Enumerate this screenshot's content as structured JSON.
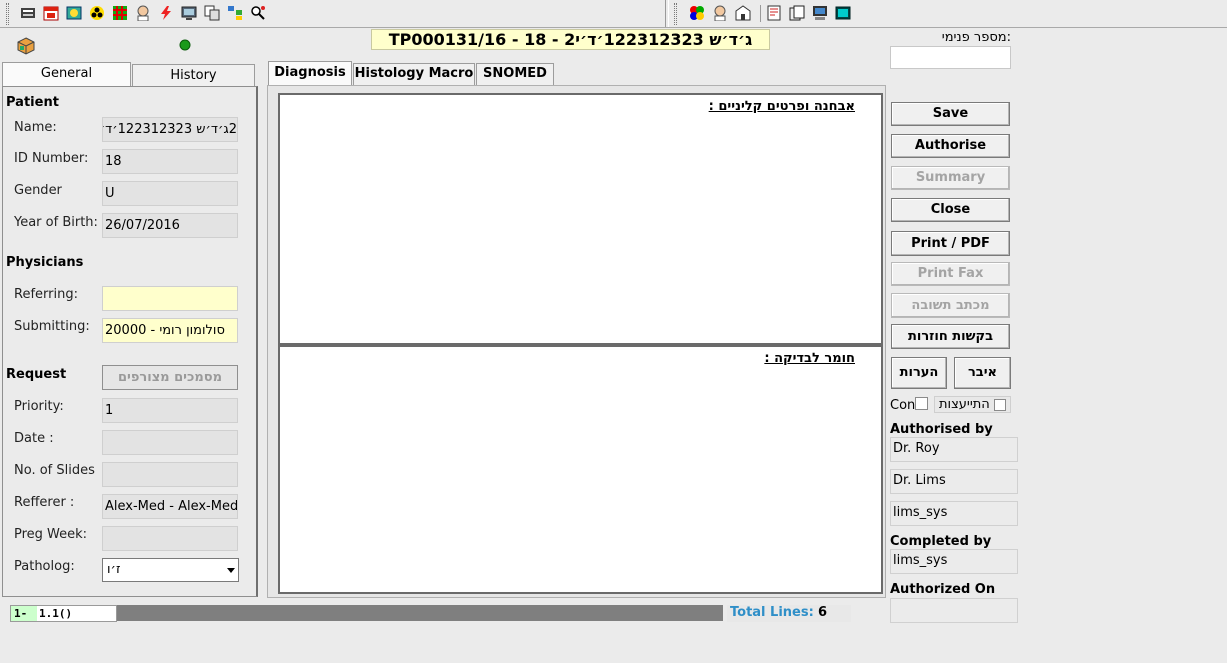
{
  "title": "TP000131/16 - 18 - 2ג׳ד׳ש 122312323׳ד׳י",
  "internal_number_label": "מספר פנימי:",
  "internal_number_value": "",
  "left_tabs": [
    "General",
    "History"
  ],
  "patient": {
    "heading": "Patient",
    "name_label": "Name:",
    "name_value": "2ג׳ד׳ש 122312323׳ד׳י",
    "id_label": "ID Number:",
    "id_value": "18",
    "gender_label": "Gender",
    "gender_value": "U",
    "yob_label": "Year of Birth:",
    "yob_value": "26/07/2016"
  },
  "physicians": {
    "heading": "Physicians",
    "referring_label": "Referring:",
    "referring_value": "",
    "submitting_label": "Submitting:",
    "submitting_value": "סולומון רומי - 20000"
  },
  "request": {
    "heading": "Request",
    "docs_button": "מסמכים מצורפים",
    "priority_label": "Priority:",
    "priority_value": "1",
    "date_label": "Date :",
    "date_value": "",
    "slides_label": "No. of Slides",
    "slides_value": "",
    "refferer_label": "Refferer :",
    "refferer_value": "Alex-Med - Alex-Med",
    "preg_label": "Preg Week:",
    "preg_value": "",
    "patholog_label": "Patholog:",
    "patholog_value": "ז׳ו"
  },
  "center_tabs": [
    "Diagnosis",
    "Histology Macro",
    "SNOMED"
  ],
  "editors": {
    "top_heading": "אבחנה ופרטים קליניים :",
    "bottom_heading": "חומר לבדיקה :"
  },
  "buttons": {
    "save": "Save",
    "authorise": "Authorise",
    "summary": "Summary",
    "close": "Close",
    "print_pdf": "Print / PDF",
    "print_fax": "Print Fax",
    "reply_letter": "מכתב תשובה",
    "return_requests": "בקשות חוזרות",
    "notes": "הערות",
    "organ": "איבר"
  },
  "checkboxes": {
    "con_label": "Con",
    "consult_label": "התייעצות"
  },
  "authorised_by": {
    "label": "Authorised by",
    "values": [
      "Dr. Roy",
      "Dr. Lims",
      "lims_sys"
    ]
  },
  "completed_by": {
    "label": "Completed by",
    "value": "lims_sys"
  },
  "authorized_on": {
    "label": "Authorized On",
    "value": ""
  },
  "status": {
    "line_number": "1-",
    "position": "1.1()",
    "total_label": "Total Lines:",
    "total_value": "6"
  }
}
